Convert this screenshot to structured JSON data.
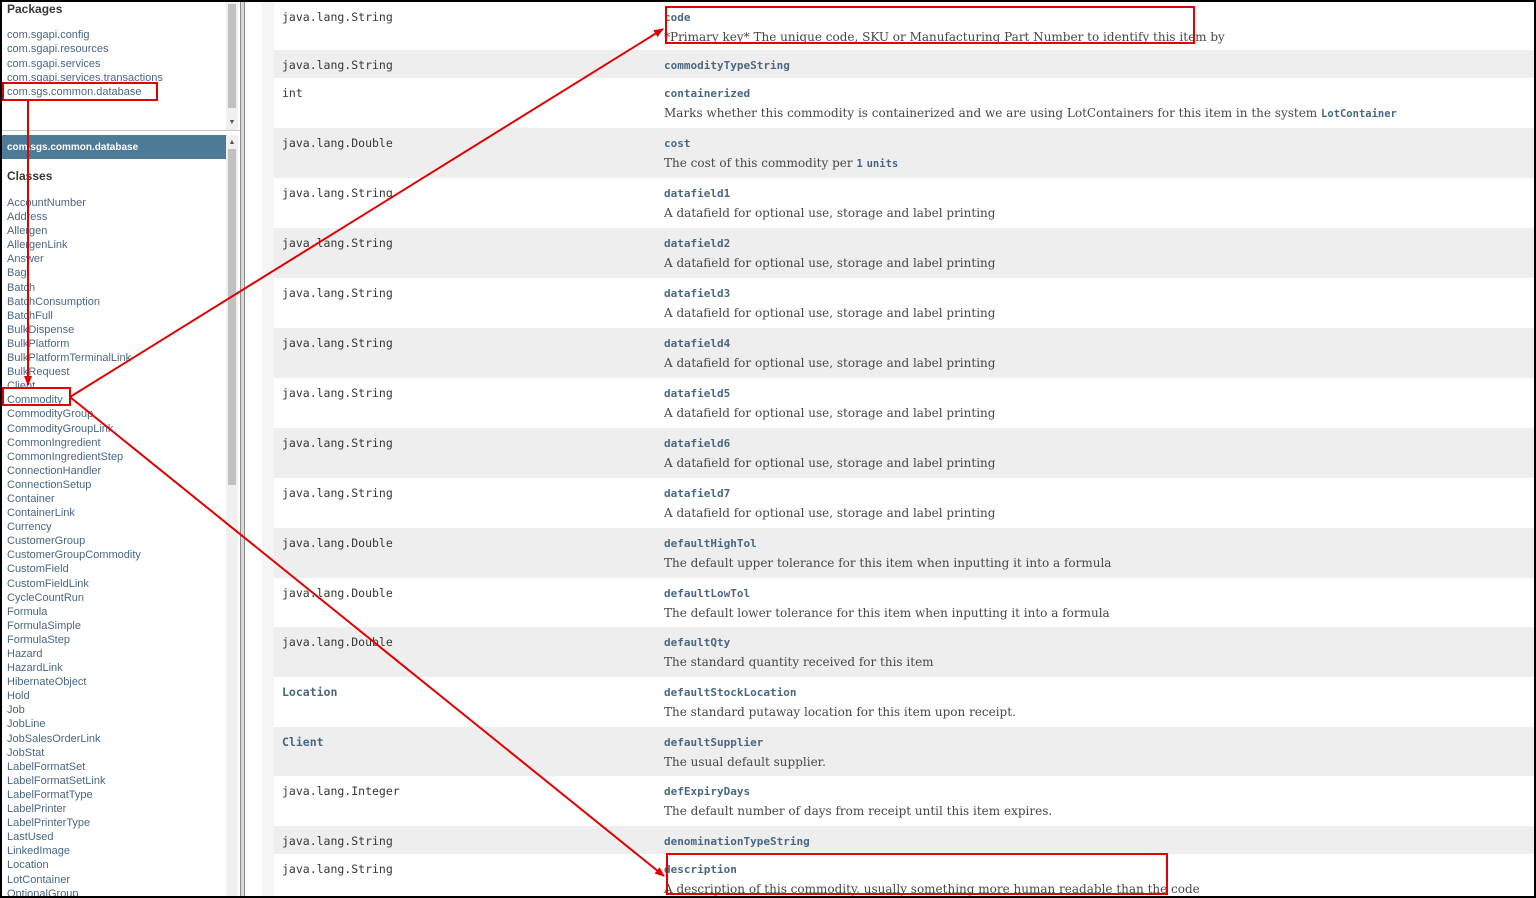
{
  "packages": {
    "title": "Packages",
    "items": [
      "com.sgapi.config",
      "com.sgapi.resources",
      "com.sgapi.services",
      "com.sgapi.services.transactions",
      "com.sgs.common.database"
    ]
  },
  "classes_pane": {
    "header": "com.sgs.common.database",
    "title": "Classes",
    "items": [
      "AccountNumber",
      "Address",
      "Allergen",
      "AllergenLink",
      "Answer",
      "Bag",
      "Batch",
      "BatchConsumption",
      "BatchFull",
      "BulkDispense",
      "BulkPlatform",
      "BulkPlatformTerminalLink",
      "BulkRequest",
      "Client",
      "Commodity",
      "CommodityGroup",
      "CommodityGroupLink",
      "CommonIngredient",
      "CommonIngredientStep",
      "ConnectionHandler",
      "ConnectionSetup",
      "Container",
      "ContainerLink",
      "Currency",
      "CustomerGroup",
      "CustomerGroupCommodity",
      "CustomField",
      "CustomFieldLink",
      "CycleCountRun",
      "Formula",
      "FormulaSimple",
      "FormulaStep",
      "Hazard",
      "HazardLink",
      "HibernateObject",
      "Hold",
      "Job",
      "JobLine",
      "JobSalesOrderLink",
      "JobStat",
      "LabelFormatSet",
      "LabelFormatSetLink",
      "LabelFormatType",
      "LabelPrinter",
      "LabelPrinterType",
      "LastUsed",
      "LinkedImage",
      "Location",
      "LotContainer",
      "OptionalGroup"
    ]
  },
  "fields": [
    {
      "type": "java.lang.String",
      "name": "code",
      "desc": "*Primary key* The unique code, SKU or Manufacturing Part Number to identify this item by"
    },
    {
      "type": "java.lang.String",
      "name": "commodityTypeString",
      "desc": ""
    },
    {
      "type": "int",
      "name": "containerized",
      "desc": "Marks whether this commodity is containerized and we are using LotContainers for this item in the system",
      "code": "LotContainer"
    },
    {
      "type": "java.lang.Double",
      "name": "cost",
      "desc": "The cost of this commodity per",
      "code_pre": "1",
      "code": "units"
    },
    {
      "type": "java.lang.String",
      "name": "datafield1",
      "desc": "A datafield for optional use, storage and label printing"
    },
    {
      "type": "java.lang.String",
      "name": "datafield2",
      "desc": "A datafield for optional use, storage and label printing"
    },
    {
      "type": "java.lang.String",
      "name": "datafield3",
      "desc": "A datafield for optional use, storage and label printing"
    },
    {
      "type": "java.lang.String",
      "name": "datafield4",
      "desc": "A datafield for optional use, storage and label printing"
    },
    {
      "type": "java.lang.String",
      "name": "datafield5",
      "desc": "A datafield for optional use, storage and label printing"
    },
    {
      "type": "java.lang.String",
      "name": "datafield6",
      "desc": "A datafield for optional use, storage and label printing"
    },
    {
      "type": "java.lang.String",
      "name": "datafield7",
      "desc": "A datafield for optional use, storage and label printing"
    },
    {
      "type": "java.lang.Double",
      "name": "defaultHighTol",
      "desc": "The default upper tolerance for this item when inputting it into a formula"
    },
    {
      "type": "java.lang.Double",
      "name": "defaultLowTol",
      "desc": "The default lower tolerance for this item when inputting it into a formula"
    },
    {
      "type": "java.lang.Double",
      "name": "defaultQty",
      "desc": "The standard quantity received for this item"
    },
    {
      "type": "Location",
      "type_link": true,
      "name": "defaultStockLocation",
      "desc": "The standard putaway location for this item upon receipt."
    },
    {
      "type": "Client",
      "type_link": true,
      "name": "defaultSupplier",
      "desc": "The usual default supplier."
    },
    {
      "type": "java.lang.Integer",
      "name": "defExpiryDays",
      "desc": "The default number of days from receipt until this item expires."
    },
    {
      "type": "java.lang.String",
      "name": "denominationTypeString",
      "desc": ""
    },
    {
      "type": "java.lang.String",
      "name": "description",
      "desc": "A description of this commodity, usually something more human readable than the code"
    }
  ],
  "colors": {
    "link": "#4a6782",
    "header_bar": "#4d7a97",
    "annotation": "#e00000",
    "row_alt": "#eeeeef"
  }
}
